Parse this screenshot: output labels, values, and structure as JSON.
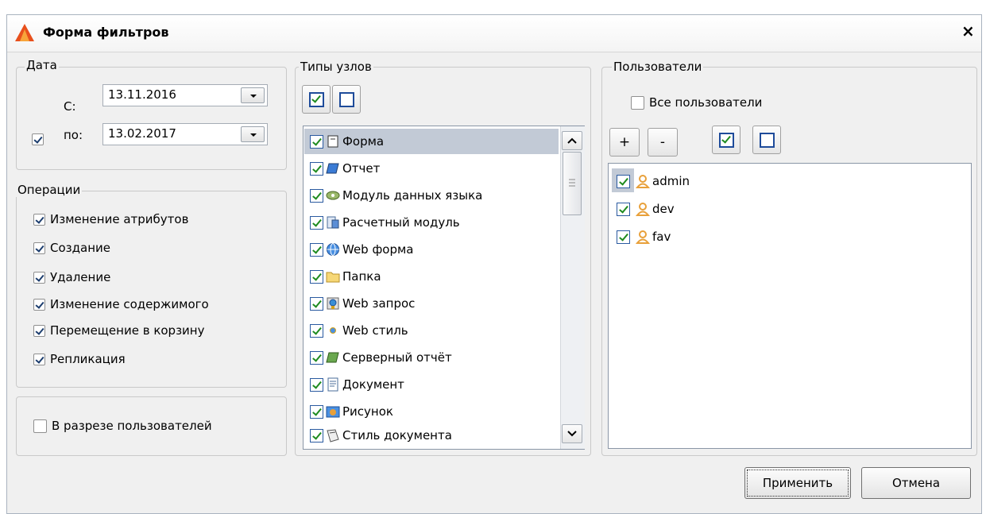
{
  "window": {
    "title": "Форма фильтров",
    "close_label": "×"
  },
  "date_group": {
    "legend": "Дата",
    "from_label": "С:",
    "from_value": "13.11.2016",
    "to_label": "по:",
    "to_value": "13.02.2017",
    "to_checked": true
  },
  "operations": {
    "legend": "Операции",
    "items": [
      {
        "label": "Изменение атрибутов",
        "checked": true
      },
      {
        "label": "Создание",
        "checked": true
      },
      {
        "label": "Удаление",
        "checked": true
      },
      {
        "label": "Изменение содержимого",
        "checked": true
      },
      {
        "label": "Перемещение в корзину",
        "checked": true
      },
      {
        "label": "Репликация",
        "checked": true
      }
    ]
  },
  "by_users": {
    "label": "В разрезе пользователей",
    "checked": false
  },
  "node_types": {
    "legend": "Типы узлов",
    "items": [
      {
        "label": "Форма",
        "icon": "form-icon",
        "selected": true
      },
      {
        "label": "Отчет",
        "icon": "report-icon"
      },
      {
        "label": "Модуль данных языка",
        "icon": "language-module-icon"
      },
      {
        "label": "Расчетный модуль",
        "icon": "calc-module-icon"
      },
      {
        "label": "Web форма",
        "icon": "web-form-icon"
      },
      {
        "label": "Папка",
        "icon": "folder-icon"
      },
      {
        "label": "Web запрос",
        "icon": "web-request-icon"
      },
      {
        "label": "Web стиль",
        "icon": "web-style-icon"
      },
      {
        "label": "Серверный отчёт",
        "icon": "server-report-icon"
      },
      {
        "label": "Документ",
        "icon": "document-icon"
      },
      {
        "label": "Рисунок",
        "icon": "picture-icon"
      },
      {
        "label": "Стиль документа",
        "icon": "document-style-icon"
      }
    ]
  },
  "users": {
    "legend": "Пользователи",
    "all_label": "Все пользователи",
    "all_checked": false,
    "add_label": "+",
    "remove_label": "-",
    "items": [
      {
        "name": "admin"
      },
      {
        "name": "dev"
      },
      {
        "name": "fav"
      }
    ]
  },
  "actions": {
    "apply": "Применить",
    "cancel": "Отмена"
  },
  "colors": {
    "accent": "#1e4b9a",
    "check": "#1e8b1e",
    "selection": "#c2cad6",
    "user_icon": "#e8a03a",
    "logo": "#e8501c"
  }
}
